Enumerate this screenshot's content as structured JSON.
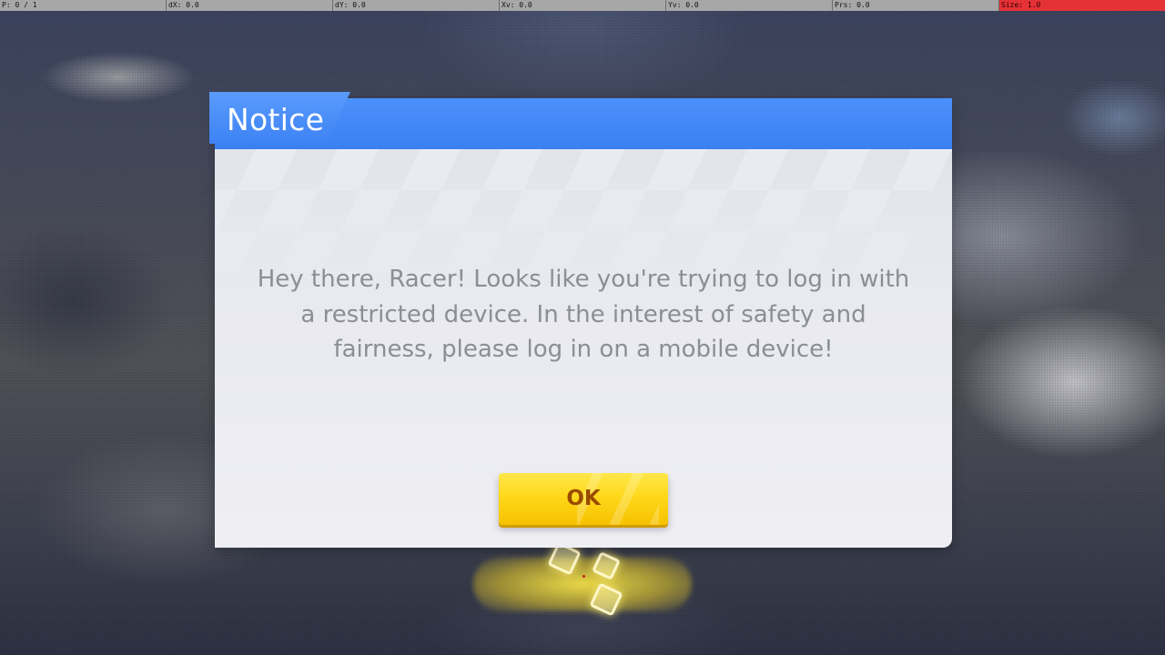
{
  "debug_overlay": {
    "pointer": "P: 0 / 1",
    "dx": "dX: 0.0",
    "dy": "dY: 0.0",
    "xv": "Xv: 0.0",
    "yv": "Yv: 0.0",
    "prs": "Prs: 0.0",
    "size": "Size: 1.0",
    "size_color": "#e53236"
  },
  "dialog": {
    "title": "Notice",
    "message": "Hey there, Racer! Looks like you're trying to log in with a restricted device. In the interest of safety and fairness, please log in on a mobile device!",
    "ok_label": "OK",
    "header_color": "#3a80f2",
    "button_color": "#ffd81b"
  }
}
